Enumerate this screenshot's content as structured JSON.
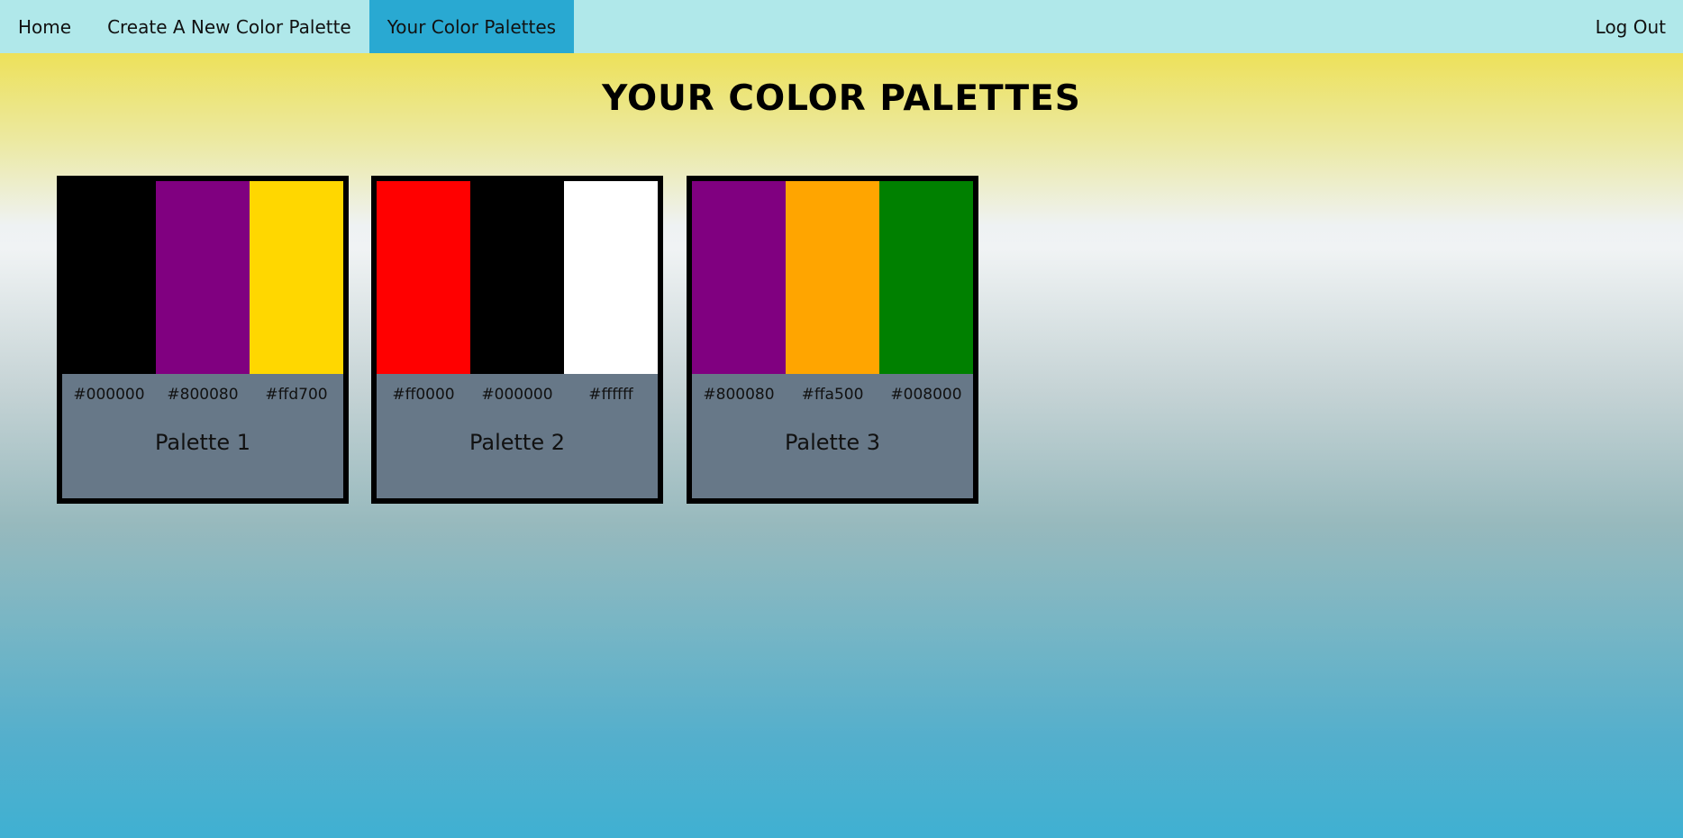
{
  "nav": {
    "home": "Home",
    "create": "Create A New Color Palette",
    "yours": "Your Color Palettes",
    "logout": "Log Out"
  },
  "page": {
    "title": "YOUR COLOR PALETTES"
  },
  "palettes": [
    {
      "name": "Palette 1",
      "colors": [
        "#000000",
        "#800080",
        "#ffd700"
      ]
    },
    {
      "name": "Palette 2",
      "colors": [
        "#ff0000",
        "#000000",
        "#ffffff"
      ]
    },
    {
      "name": "Palette 3",
      "colors": [
        "#800080",
        "#ffa500",
        "#008000"
      ]
    }
  ],
  "theme": {
    "navbar_bg": "#b0e8ea",
    "active_tab_bg": "#29a9d2",
    "card_bg": "#677888"
  }
}
